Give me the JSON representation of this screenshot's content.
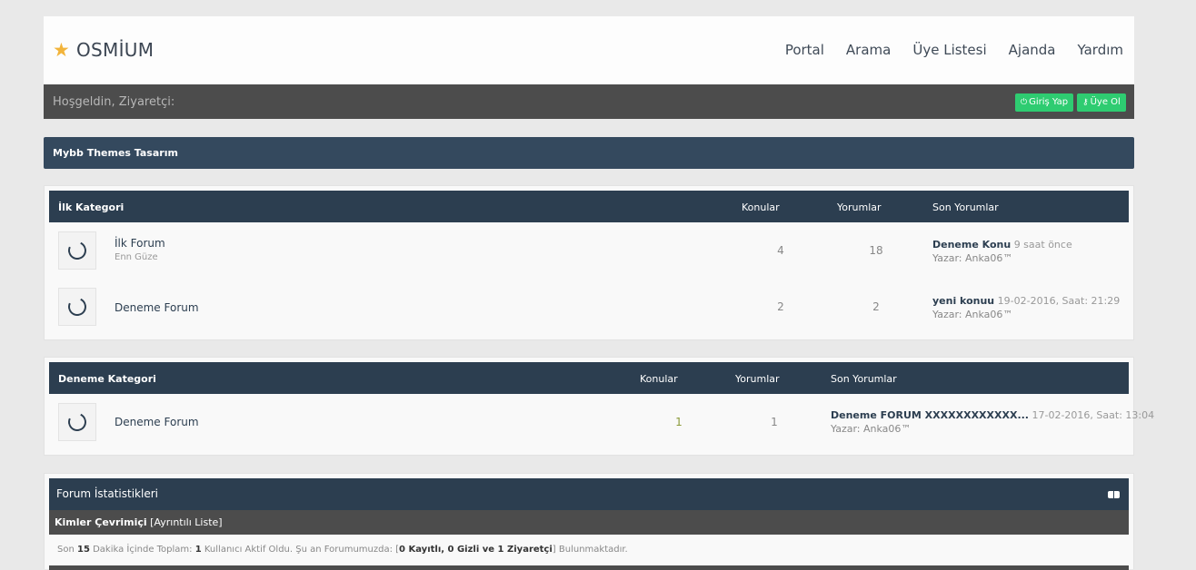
{
  "site": {
    "logo_text": "OSMİUM",
    "nav": [
      "Portal",
      "Arama",
      "Üye Listesi",
      "Ajanda",
      "Yardım"
    ],
    "welcome": "Hoşgeldin, Ziyaretçi:",
    "login_label": "Giriş Yap",
    "register_label": "Üye Ol",
    "accent": "#2ecc71",
    "star_color": "#f2b43b"
  },
  "theme_bar": "Mybb Themes Tasarım",
  "categories": [
    {
      "title": "İlk Kategori",
      "col_topics": "Konular",
      "col_posts": "Yorumlar",
      "col_last": "Son Yorumlar",
      "forums": [
        {
          "name": "İlk Forum",
          "desc": "Enn Güze",
          "topics": "4",
          "posts": "18",
          "last_title": "Deneme Konu",
          "last_time": "9 saat önce",
          "last_author": "Yazar: Anka06™"
        },
        {
          "name": "Deneme Forum",
          "desc": "",
          "topics": "2",
          "posts": "2",
          "last_title": "yeni konuu",
          "last_time": "19-02-2016, Saat: 21:29",
          "last_author": "Yazar: Anka06™"
        }
      ]
    },
    {
      "title": "Deneme Kategori",
      "col_topics": "Konular",
      "col_posts": "Yorumlar",
      "col_last": "Son Yorumlar",
      "forums": [
        {
          "name": "Deneme Forum",
          "desc": "",
          "topics": "1",
          "posts": "1",
          "last_title": "Deneme FORUM XXXXXXXXXXXX...",
          "last_time": "17-02-2016, Saat: 13:04",
          "last_author": "Yazar: Anka06™"
        }
      ]
    }
  ],
  "stats": {
    "title": "Forum İstatistikleri",
    "online_title": "Kimler Çevrimiçi",
    "online_link": "[Ayrıntılı Liste]",
    "online_pre": "Son ",
    "online_minutes": "15",
    "online_mid1": " Dakika İçinde Toplam: ",
    "online_users": "1",
    "online_mid2": " Kullanıcı Aktif Oldu. Şu an Forumumuzda: [",
    "online_counts": "0 Kayıtlı, 0 Gizli ve 1 Ziyaretçi",
    "online_post": "] Bulunmaktadır."
  }
}
